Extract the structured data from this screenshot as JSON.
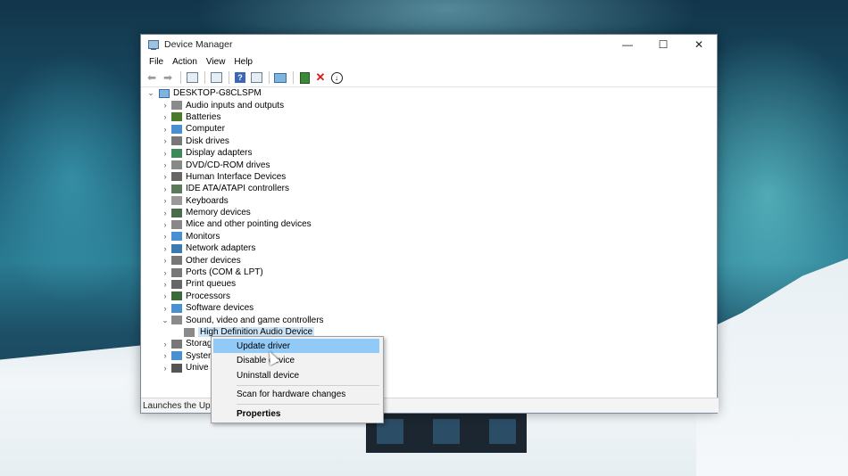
{
  "window": {
    "title": "Device Manager",
    "controls": {
      "minimize": "—",
      "maximize": "☐",
      "close": "✕"
    }
  },
  "menubar": [
    "File",
    "Action",
    "View",
    "Help"
  ],
  "toolbar": {
    "icons": [
      "back-arrow-icon",
      "forward-arrow-icon",
      "properties-icon",
      "tree-view-icon",
      "help-icon",
      "device-view-icon",
      "scan-monitor-icon",
      "enable-device-icon",
      "uninstall-icon",
      "update-driver-icon"
    ]
  },
  "tree": {
    "root": "DESKTOP-G8CLSPM",
    "categories": [
      {
        "label": "Audio inputs and outputs",
        "icon": "speaker-icon",
        "color": "#8a8a8a",
        "expanded": false
      },
      {
        "label": "Batteries",
        "icon": "battery-icon",
        "color": "#4a7a2a",
        "expanded": false
      },
      {
        "label": "Computer",
        "icon": "computer-icon",
        "color": "#4a8fd0",
        "expanded": false
      },
      {
        "label": "Disk drives",
        "icon": "disk-icon",
        "color": "#777777",
        "expanded": false
      },
      {
        "label": "Display adapters",
        "icon": "display-adapter-icon",
        "color": "#3a8a5a",
        "expanded": false
      },
      {
        "label": "DVD/CD-ROM drives",
        "icon": "dvd-icon",
        "color": "#888888",
        "expanded": false
      },
      {
        "label": "Human Interface Devices",
        "icon": "hid-icon",
        "color": "#666666",
        "expanded": false
      },
      {
        "label": "IDE ATA/ATAPI controllers",
        "icon": "ide-controller-icon",
        "color": "#5a7a5a",
        "expanded": false
      },
      {
        "label": "Keyboards",
        "icon": "keyboard-icon",
        "color": "#999999",
        "expanded": false
      },
      {
        "label": "Memory devices",
        "icon": "memory-icon",
        "color": "#4a6a4a",
        "expanded": false
      },
      {
        "label": "Mice and other pointing devices",
        "icon": "mouse-icon",
        "color": "#888888",
        "expanded": false
      },
      {
        "label": "Monitors",
        "icon": "monitor-icon",
        "color": "#4a8fd0",
        "expanded": false
      },
      {
        "label": "Network adapters",
        "icon": "network-adapter-icon",
        "color": "#3a7ab0",
        "expanded": false
      },
      {
        "label": "Other devices",
        "icon": "other-devices-icon",
        "color": "#777777",
        "expanded": false
      },
      {
        "label": "Ports (COM & LPT)",
        "icon": "port-icon",
        "color": "#777777",
        "expanded": false
      },
      {
        "label": "Print queues",
        "icon": "printer-icon",
        "color": "#666666",
        "expanded": false
      },
      {
        "label": "Processors",
        "icon": "processor-icon",
        "color": "#3a6a3a",
        "expanded": false
      },
      {
        "label": "Software devices",
        "icon": "software-device-icon",
        "color": "#4a8fd0",
        "expanded": false
      },
      {
        "label": "Sound, video and game controllers",
        "icon": "sound-controller-icon",
        "color": "#8a8a8a",
        "expanded": true,
        "children": [
          {
            "label": "High Definition Audio Device",
            "icon": "audio-device-icon",
            "color": "#8a8a8a"
          }
        ]
      },
      {
        "label": "Storag",
        "icon": "storage-icon",
        "color": "#777777",
        "expanded": false
      },
      {
        "label": "Syster",
        "icon": "system-icon",
        "color": "#4a8fd0",
        "expanded": false
      },
      {
        "label": "Unive",
        "icon": "usb-icon",
        "color": "#555555",
        "expanded": false
      }
    ]
  },
  "status_bar": "Launches the Upd",
  "context_menu": {
    "items": [
      {
        "label": "Update driver",
        "highlighted": true
      },
      {
        "label": "Disable device",
        "highlighted": false
      },
      {
        "label": "Uninstall device",
        "highlighted": false
      },
      {
        "label": "Scan for hardware changes",
        "highlighted": false
      },
      {
        "label": "Properties",
        "highlighted": false,
        "bold": true
      }
    ]
  },
  "colors": {
    "highlight": "#91c9f7",
    "selection": "#cce4f7"
  }
}
